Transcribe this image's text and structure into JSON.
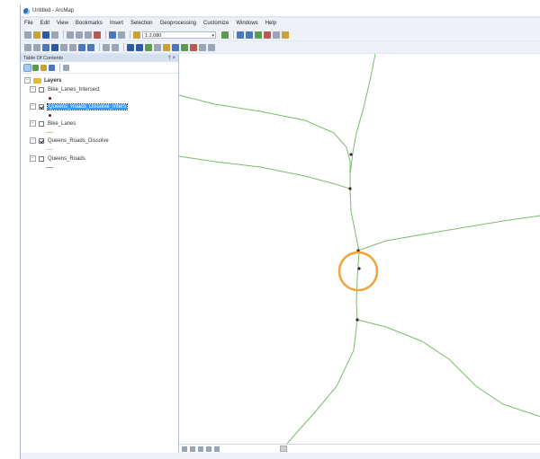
{
  "window": {
    "title": "Untitled - ArcMap"
  },
  "menu": {
    "items": [
      "File",
      "Edit",
      "View",
      "Bookmarks",
      "Insert",
      "Selection",
      "Geoprocessing",
      "Customize",
      "Windows",
      "Help"
    ]
  },
  "toolbar": {
    "scale_value": "1:2,080"
  },
  "toc": {
    "title": "Table Of Contents",
    "controls": "† ×",
    "group": {
      "label": "Layers"
    },
    "layers": [
      {
        "label": "Bike_Lanes_Intersect",
        "checked": false,
        "selected": false,
        "symbol": "point",
        "symbol_color": "#4a1a34"
      },
      {
        "label": "Queens_Roads_Dissolve_Inters",
        "checked": true,
        "selected": true,
        "symbol": "point",
        "symbol_color": "#4a1a34"
      },
      {
        "label": "Bike_Lanes",
        "checked": false,
        "selected": false,
        "symbol": "line",
        "symbol_color": "#d7c878"
      },
      {
        "label": "Queens_Roads_Dissolve",
        "checked": true,
        "selected": false,
        "symbol": "line",
        "symbol_color": "#cfd6cf"
      },
      {
        "label": "Queens_Roads",
        "checked": false,
        "selected": false,
        "symbol": "line",
        "symbol_color": "#9aa3ad"
      }
    ]
  },
  "map": {
    "road_color": "#7dba70",
    "intersection_color": "#4a1a34",
    "highlight_circle_color": "#f2a33a"
  }
}
